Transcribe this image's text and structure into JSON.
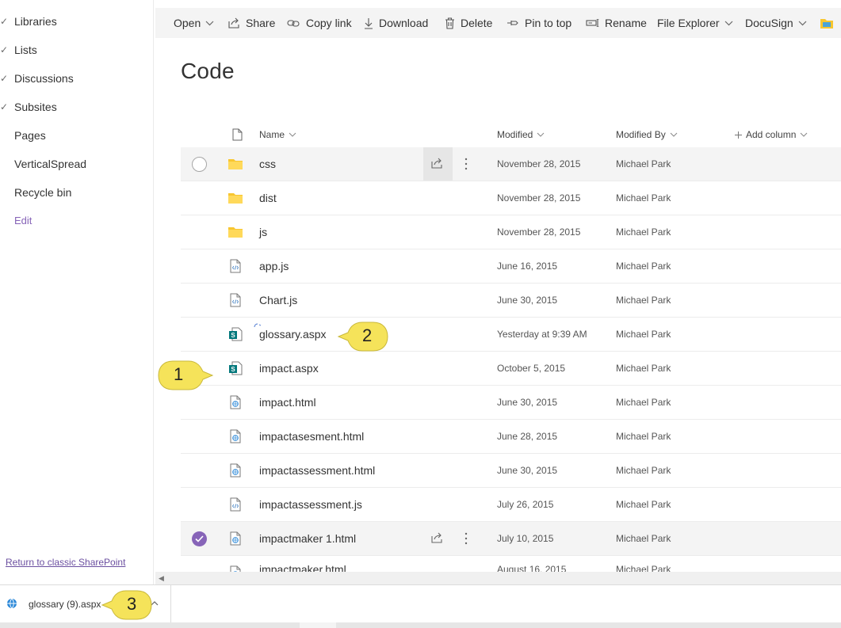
{
  "sidebar": {
    "items": [
      {
        "label": "Libraries",
        "checked": true
      },
      {
        "label": "Lists",
        "checked": true
      },
      {
        "label": "Discussions",
        "checked": true
      },
      {
        "label": "Subsites",
        "checked": true
      },
      {
        "label": "Pages",
        "checked": false
      },
      {
        "label": "VerticalSpread",
        "checked": false
      },
      {
        "label": "Recycle bin",
        "checked": false
      }
    ],
    "edit_label": "Edit",
    "return_link": "Return to classic SharePoint"
  },
  "commandbar": {
    "open": "Open",
    "share": "Share",
    "copy_link": "Copy link",
    "download": "Download",
    "delete": "Delete",
    "pin_to_top": "Pin to top",
    "rename": "Rename",
    "file_explorer": "File Explorer",
    "docusign": "DocuSign"
  },
  "page_title": "Code",
  "columns": {
    "name": "Name",
    "modified": "Modified",
    "modified_by": "Modified By",
    "add_column": "Add column"
  },
  "files": [
    {
      "name": "css",
      "type": "folder",
      "modified": "November 28, 2015",
      "modified_by": "Michael Park"
    },
    {
      "name": "dist",
      "type": "folder",
      "modified": "November 28, 2015",
      "modified_by": "Michael Park"
    },
    {
      "name": "js",
      "type": "folder",
      "modified": "November 28, 2015",
      "modified_by": "Michael Park"
    },
    {
      "name": "app.js",
      "type": "code",
      "modified": "June 16, 2015",
      "modified_by": "Michael Park"
    },
    {
      "name": "Chart.js",
      "type": "code",
      "modified": "June 30, 2015",
      "modified_by": "Michael Park"
    },
    {
      "name": "glossary.aspx",
      "type": "aspx",
      "modified": "Yesterday at 9:39 AM",
      "modified_by": "Michael Park"
    },
    {
      "name": "impact.aspx",
      "type": "aspx",
      "modified": "October 5, 2015",
      "modified_by": "Michael Park"
    },
    {
      "name": "impact.html",
      "type": "html",
      "modified": "June 30, 2015",
      "modified_by": "Michael Park"
    },
    {
      "name": "impactasesment.html",
      "type": "html",
      "modified": "June 28, 2015",
      "modified_by": "Michael Park"
    },
    {
      "name": "impactassessment.html",
      "type": "html",
      "modified": "June 30, 2015",
      "modified_by": "Michael Park"
    },
    {
      "name": "impactassessment.js",
      "type": "code",
      "modified": "July 26, 2015",
      "modified_by": "Michael Park"
    },
    {
      "name": "impactmaker 1.html",
      "type": "html",
      "modified": "July 10, 2015",
      "modified_by": "Michael Park"
    },
    {
      "name": "impactmaker.html",
      "type": "html",
      "modified": "August 16, 2015",
      "modified_by": "Michael Park"
    }
  ],
  "callouts": [
    "1",
    "2",
    "3"
  ],
  "download_bar": {
    "filename": "glossary (9).aspx"
  },
  "colors": {
    "accent_purple": "#8764b8",
    "folder_yellow": "#f8c630",
    "sharepoint_green": "#03787c",
    "callout_yellow": "#f5e35a"
  }
}
